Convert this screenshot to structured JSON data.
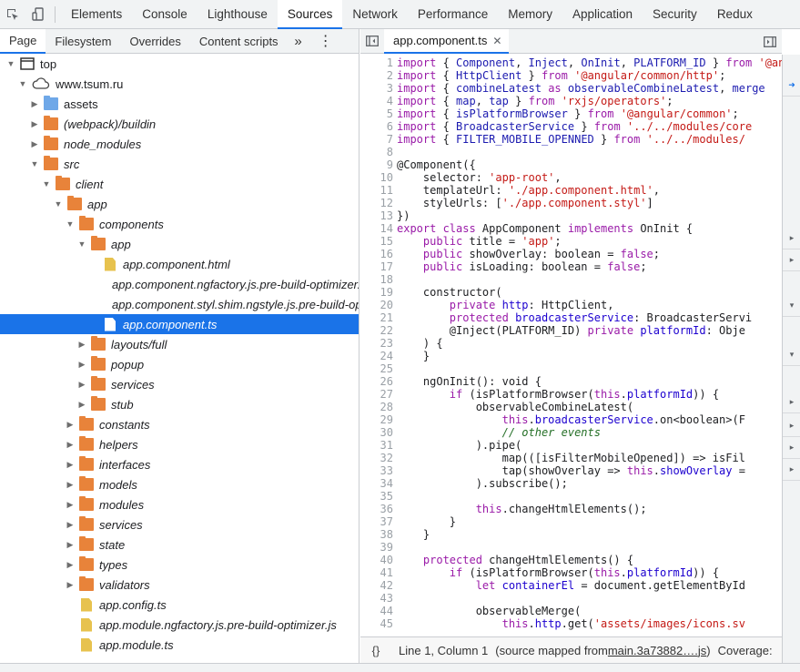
{
  "panel_tabs": [
    "Elements",
    "Console",
    "Lighthouse",
    "Sources",
    "Network",
    "Performance",
    "Memory",
    "Application",
    "Security",
    "Redux"
  ],
  "active_panel": "Sources",
  "navigator": {
    "tabs": [
      "Page",
      "Filesystem",
      "Overrides",
      "Content scripts"
    ],
    "more": "»",
    "menu": "⋮"
  },
  "tree": [
    {
      "label": "top",
      "depth": 0,
      "expanded": true,
      "type": "frame"
    },
    {
      "label": "www.tsum.ru",
      "depth": 1,
      "expanded": true,
      "type": "cloud"
    },
    {
      "label": "assets",
      "depth": 2,
      "expanded": false,
      "type": "folder-blue"
    },
    {
      "label": "(webpack)/buildin",
      "depth": 2,
      "expanded": false,
      "type": "folder",
      "italic": true
    },
    {
      "label": "node_modules",
      "depth": 2,
      "expanded": false,
      "type": "folder",
      "italic": true
    },
    {
      "label": "src",
      "depth": 2,
      "expanded": true,
      "type": "folder",
      "italic": true
    },
    {
      "label": "client",
      "depth": 3,
      "expanded": true,
      "type": "folder",
      "italic": true
    },
    {
      "label": "app",
      "depth": 4,
      "expanded": true,
      "type": "folder",
      "italic": true
    },
    {
      "label": "components",
      "depth": 5,
      "expanded": true,
      "type": "folder",
      "italic": true
    },
    {
      "label": "app",
      "depth": 6,
      "expanded": true,
      "type": "folder",
      "italic": true
    },
    {
      "label": "app.component.html",
      "depth": 7,
      "type": "file",
      "italic": true
    },
    {
      "label": "app.component.ngfactory.js.pre-build-optimizer.js",
      "depth": 7,
      "type": "file",
      "italic": true
    },
    {
      "label": "app.component.styl.shim.ngstyle.js.pre-build-optimizer.js",
      "depth": 7,
      "type": "file",
      "italic": true
    },
    {
      "label": "app.component.ts",
      "depth": 7,
      "type": "file-white",
      "italic": true,
      "selected": true
    },
    {
      "label": "layouts/full",
      "depth": 6,
      "expanded": false,
      "type": "folder",
      "italic": true
    },
    {
      "label": "popup",
      "depth": 6,
      "expanded": false,
      "type": "folder",
      "italic": true
    },
    {
      "label": "services",
      "depth": 6,
      "expanded": false,
      "type": "folder",
      "italic": true
    },
    {
      "label": "stub",
      "depth": 6,
      "expanded": false,
      "type": "folder",
      "italic": true
    },
    {
      "label": "constants",
      "depth": 5,
      "expanded": false,
      "type": "folder",
      "italic": true
    },
    {
      "label": "helpers",
      "depth": 5,
      "expanded": false,
      "type": "folder",
      "italic": true
    },
    {
      "label": "interfaces",
      "depth": 5,
      "expanded": false,
      "type": "folder",
      "italic": true
    },
    {
      "label": "models",
      "depth": 5,
      "expanded": false,
      "type": "folder",
      "italic": true
    },
    {
      "label": "modules",
      "depth": 5,
      "expanded": false,
      "type": "folder",
      "italic": true
    },
    {
      "label": "services",
      "depth": 5,
      "expanded": false,
      "type": "folder",
      "italic": true
    },
    {
      "label": "state",
      "depth": 5,
      "expanded": false,
      "type": "folder",
      "italic": true
    },
    {
      "label": "types",
      "depth": 5,
      "expanded": false,
      "type": "folder",
      "italic": true
    },
    {
      "label": "validators",
      "depth": 5,
      "expanded": false,
      "type": "folder",
      "italic": true
    },
    {
      "label": "app.config.ts",
      "depth": 5,
      "type": "file",
      "italic": true
    },
    {
      "label": "app.module.ngfactory.js.pre-build-optimizer.js",
      "depth": 5,
      "type": "file",
      "italic": true
    },
    {
      "label": "app.module.ts",
      "depth": 5,
      "type": "file",
      "italic": true
    }
  ],
  "editor": {
    "tab_label": "app.component.ts",
    "tab_close": "✕",
    "lines": [
      [
        [
          "k",
          "import"
        ],
        [
          "t",
          " { "
        ],
        [
          "v2",
          "Component"
        ],
        [
          "t",
          ", "
        ],
        [
          "v2",
          "Inject"
        ],
        [
          "t",
          ", "
        ],
        [
          "v2",
          "OnInit"
        ],
        [
          "t",
          ", "
        ],
        [
          "v2",
          "PLATFORM_ID"
        ],
        [
          "t",
          " } "
        ],
        [
          "k",
          "from"
        ],
        [
          "t",
          " "
        ],
        [
          "s",
          "'@angular/core'"
        ],
        [
          "t",
          ";"
        ]
      ],
      [
        [
          "k",
          "import"
        ],
        [
          "t",
          " { "
        ],
        [
          "v2",
          "HttpClient"
        ],
        [
          "t",
          " } "
        ],
        [
          "k",
          "from"
        ],
        [
          "t",
          " "
        ],
        [
          "s",
          "'@angular/common/http'"
        ],
        [
          "t",
          ";"
        ]
      ],
      [
        [
          "k",
          "import"
        ],
        [
          "t",
          " { "
        ],
        [
          "v2",
          "combineLatest"
        ],
        [
          "t",
          " "
        ],
        [
          "k",
          "as"
        ],
        [
          "t",
          " "
        ],
        [
          "v2",
          "observableCombineLatest"
        ],
        [
          "t",
          ", "
        ],
        [
          "v2",
          "merge"
        ]
      ],
      [
        [
          "k",
          "import"
        ],
        [
          "t",
          " { "
        ],
        [
          "v2",
          "map"
        ],
        [
          "t",
          ", "
        ],
        [
          "v2",
          "tap"
        ],
        [
          "t",
          " } "
        ],
        [
          "k",
          "from"
        ],
        [
          "t",
          " "
        ],
        [
          "s",
          "'rxjs/operators'"
        ],
        [
          "t",
          ";"
        ]
      ],
      [
        [
          "k",
          "import"
        ],
        [
          "t",
          " { "
        ],
        [
          "v2",
          "isPlatformBrowser"
        ],
        [
          "t",
          " } "
        ],
        [
          "k",
          "from"
        ],
        [
          "t",
          " "
        ],
        [
          "s",
          "'@angular/common'"
        ],
        [
          "t",
          ";"
        ]
      ],
      [
        [
          "k",
          "import"
        ],
        [
          "t",
          " { "
        ],
        [
          "v2",
          "BroadcasterService"
        ],
        [
          "t",
          " } "
        ],
        [
          "k",
          "from"
        ],
        [
          "t",
          " "
        ],
        [
          "s",
          "'../../modules/core"
        ]
      ],
      [
        [
          "k",
          "import"
        ],
        [
          "t",
          " { "
        ],
        [
          "v2",
          "FILTER_MOBILE_OPENNED"
        ],
        [
          "t",
          " } "
        ],
        [
          "k",
          "from"
        ],
        [
          "t",
          " "
        ],
        [
          "s",
          "'../../modules/"
        ]
      ],
      [],
      [
        [
          "t",
          "@Component({"
        ]
      ],
      [
        [
          "t",
          "    selector: "
        ],
        [
          "s",
          "'app-root'"
        ],
        [
          "t",
          ","
        ]
      ],
      [
        [
          "t",
          "    templateUrl: "
        ],
        [
          "s",
          "'./app.component.html'"
        ],
        [
          "t",
          ","
        ]
      ],
      [
        [
          "t",
          "    styleUrls: ["
        ],
        [
          "s",
          "'./app.component.styl'"
        ],
        [
          "t",
          "]"
        ]
      ],
      [
        [
          "t",
          "})"
        ]
      ],
      [
        [
          "k",
          "export class"
        ],
        [
          "t",
          " AppComponent "
        ],
        [
          "k",
          "implements"
        ],
        [
          "t",
          " OnInit {"
        ]
      ],
      [
        [
          "t",
          "    "
        ],
        [
          "k",
          "public"
        ],
        [
          "t",
          " title = "
        ],
        [
          "s",
          "'app'"
        ],
        [
          "t",
          ";"
        ]
      ],
      [
        [
          "t",
          "    "
        ],
        [
          "k",
          "public"
        ],
        [
          "t",
          " showOverlay: boolean = "
        ],
        [
          "k",
          "false"
        ],
        [
          "t",
          ";"
        ]
      ],
      [
        [
          "t",
          "    "
        ],
        [
          "k",
          "public"
        ],
        [
          "t",
          " isLoading: boolean = "
        ],
        [
          "k",
          "false"
        ],
        [
          "t",
          ";"
        ]
      ],
      [],
      [
        [
          "t",
          "    constructor("
        ]
      ],
      [
        [
          "t",
          "        "
        ],
        [
          "k",
          "private"
        ],
        [
          "t",
          " "
        ],
        [
          "v",
          "http"
        ],
        [
          "t",
          ": HttpClient,"
        ]
      ],
      [
        [
          "t",
          "        "
        ],
        [
          "k",
          "protected"
        ],
        [
          "t",
          " "
        ],
        [
          "v",
          "broadcasterService"
        ],
        [
          "t",
          ": BroadcasterServi"
        ]
      ],
      [
        [
          "t",
          "        @Inject(PLATFORM_ID) "
        ],
        [
          "k",
          "private"
        ],
        [
          "t",
          " "
        ],
        [
          "v",
          "platformId"
        ],
        [
          "t",
          ": Obje"
        ]
      ],
      [
        [
          "t",
          "    ) {"
        ]
      ],
      [
        [
          "t",
          "    }"
        ]
      ],
      [],
      [
        [
          "t",
          "    ngOnInit(): void {"
        ]
      ],
      [
        [
          "t",
          "        "
        ],
        [
          "k",
          "if"
        ],
        [
          "t",
          " (isPlatformBrowser("
        ],
        [
          "k",
          "this"
        ],
        [
          "t",
          "."
        ],
        [
          "v",
          "platformId"
        ],
        [
          "t",
          ")) {"
        ]
      ],
      [
        [
          "t",
          "            observableCombineLatest("
        ]
      ],
      [
        [
          "t",
          "                "
        ],
        [
          "k",
          "this"
        ],
        [
          "t",
          "."
        ],
        [
          "v",
          "broadcasterService"
        ],
        [
          "t",
          ".on<boolean>(F"
        ]
      ],
      [
        [
          "t",
          "                "
        ],
        [
          "c",
          "// other events"
        ]
      ],
      [
        [
          "t",
          "            ).pipe("
        ]
      ],
      [
        [
          "t",
          "                map(([isFilterMobileOpened]) => isFil"
        ]
      ],
      [
        [
          "t",
          "                tap(showOverlay => "
        ],
        [
          "k",
          "this"
        ],
        [
          "t",
          "."
        ],
        [
          "v",
          "showOverlay"
        ],
        [
          "t",
          " ="
        ]
      ],
      [
        [
          "t",
          "            ).subscribe();"
        ]
      ],
      [],
      [
        [
          "t",
          "            "
        ],
        [
          "k",
          "this"
        ],
        [
          "t",
          ".changeHtmlElements();"
        ]
      ],
      [
        [
          "t",
          "        }"
        ]
      ],
      [
        [
          "t",
          "    }"
        ]
      ],
      [],
      [
        [
          "t",
          "    "
        ],
        [
          "k",
          "protected"
        ],
        [
          "t",
          " changeHtmlElements() {"
        ]
      ],
      [
        [
          "t",
          "        "
        ],
        [
          "k",
          "if"
        ],
        [
          "t",
          " (isPlatformBrowser("
        ],
        [
          "k",
          "this"
        ],
        [
          "t",
          "."
        ],
        [
          "v",
          "platformId"
        ],
        [
          "t",
          ")) {"
        ]
      ],
      [
        [
          "t",
          "            "
        ],
        [
          "k",
          "let"
        ],
        [
          "t",
          " "
        ],
        [
          "v",
          "containerEl"
        ],
        [
          "t",
          " = document.getElementById"
        ]
      ],
      [],
      [
        [
          "t",
          "            observableMerge("
        ]
      ],
      [
        [
          "t",
          "                "
        ],
        [
          "k",
          "this"
        ],
        [
          "t",
          "."
        ],
        [
          "v",
          "http"
        ],
        [
          "t",
          ".get("
        ],
        [
          "s",
          "'assets/images/icons.sv"
        ]
      ]
    ],
    "status": {
      "pretty_print": "{}",
      "position": "Line 1, Column 1",
      "source_prefix": "(source mapped from ",
      "source_link": "main.3a73882….js",
      "source_suffix": ")",
      "coverage": "Coverage:"
    }
  },
  "colors": {
    "accent": "#1a73e8",
    "folder": "#e8833a",
    "folder_blue": "#6fa8e8",
    "file": "#e7c24e",
    "keyword": "#9a1ba8",
    "string": "#c41a16"
  }
}
